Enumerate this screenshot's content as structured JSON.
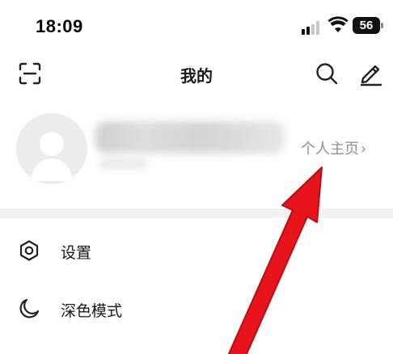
{
  "status_bar": {
    "time": "18:09",
    "battery": "56",
    "icons": [
      "signal-icon",
      "wifi-icon",
      "battery-icon"
    ]
  },
  "header": {
    "title": "我的",
    "left_icon": "scan-icon",
    "right_icons": [
      "search-icon",
      "edit-icon"
    ]
  },
  "profile": {
    "homepage_label": "个人主页",
    "chevron": "›"
  },
  "menu": {
    "items": [
      {
        "label": "设置",
        "icon": "settings-hexagon-icon"
      },
      {
        "label": "深色模式",
        "icon": "moon-icon"
      }
    ]
  },
  "annotation": {
    "type": "red-arrow",
    "color": "#e8141c"
  }
}
